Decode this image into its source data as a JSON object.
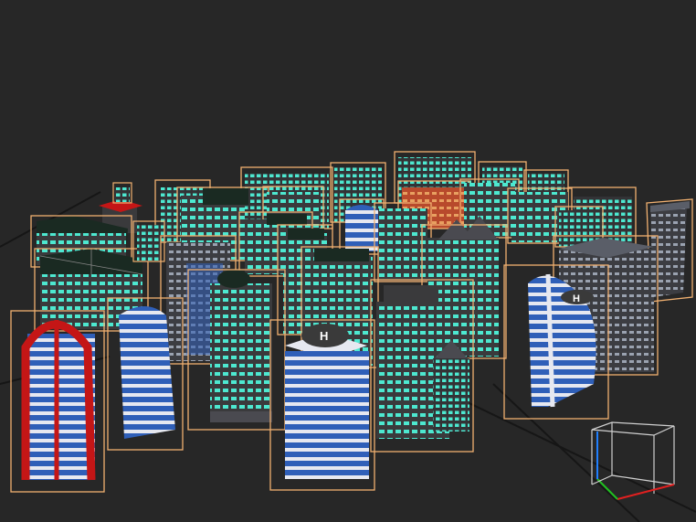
{
  "viewport": {
    "background": "#272727",
    "ground_lines": "#141414"
  },
  "colors": {
    "selection_box": "#f0b070",
    "window_cyan": "#4de8d0",
    "facade_dark": "#3c3c3e",
    "facade_blue": "#2f5fb8",
    "stripe_white": "#e6e8f0",
    "arch_red": "#c41616",
    "roof_dark": "#1a2a22",
    "helipad": "#3a3a3a",
    "helipad_mark": "#ffffff",
    "brick": "#b84a2c"
  },
  "scene": {
    "helipad_labels": [
      "H",
      "H"
    ]
  },
  "gizmo": {
    "name": "view-cube",
    "axis_colors": {
      "x": "#e02020",
      "y": "#20c020",
      "z": "#2080ff"
    },
    "edge_color": "#d0d0d0"
  }
}
